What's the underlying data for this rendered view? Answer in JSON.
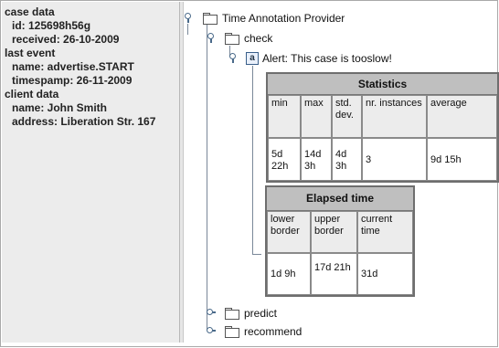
{
  "left_panel": {
    "lines": [
      "case data",
      "id: 125698h56g",
      "received: 26-10-2009",
      "last event",
      "name: advertise.START",
      "timespamp: 26-11-2009",
      "client data",
      "name: John Smith",
      "address: Liberation Str. 167"
    ]
  },
  "tree": {
    "root_label": "Time Annotation Provider",
    "check_label": "check",
    "alert_label": "Alert: This case is tooslow!",
    "alert_icon": "a",
    "predict_label": "predict",
    "recommend_label": "recommend"
  },
  "statistics": {
    "title": "Statistics",
    "headers": [
      "min",
      "max",
      "std. dev.",
      "nr. instances",
      "average"
    ],
    "values": [
      "5d 22h",
      "14d 3h",
      "4d 3h",
      "3",
      "9d 15h"
    ]
  },
  "elapsed": {
    "title": "Elapsed time",
    "headers": [
      "lower border",
      "upper border",
      "current time"
    ],
    "values": [
      "1d 9h",
      "17d 21h",
      "31d"
    ]
  },
  "icons": [
    "tree-handle-icon",
    "folder-icon",
    "alert-icon"
  ]
}
